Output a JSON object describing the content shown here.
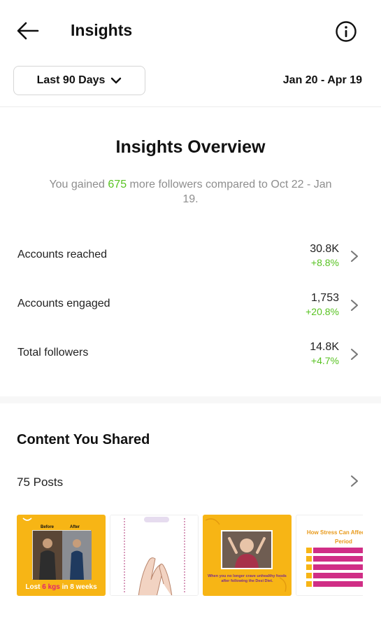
{
  "header": {
    "title": "Insights"
  },
  "range": {
    "label": "Last 90 Days",
    "dates": "Jan 20 - Apr 19"
  },
  "overview": {
    "title": "Insights Overview",
    "sub_prefix": "You gained ",
    "sub_count": "675",
    "sub_suffix": " more followers compared to Oct 22 - Jan 19."
  },
  "metrics": [
    {
      "label": "Accounts reached",
      "value": "30.8K",
      "change": "+8.8%"
    },
    {
      "label": "Accounts engaged",
      "value": "1,753",
      "change": "+20.8%"
    },
    {
      "label": "Total followers",
      "value": "14.8K",
      "change": "+4.7%"
    }
  ],
  "content": {
    "title": "Content You Shared",
    "posts_label": "75 Posts",
    "thumb1": {
      "before": "Before",
      "after": "After",
      "caption_pre": "Lost ",
      "caption_hl": "6 kgs",
      "caption_post": " in 8 weeks"
    },
    "thumb3": {
      "caption": "When you no longer crave unhealthy foods after following the Desi Diet."
    },
    "thumb4": {
      "title": "How Stress Can Affect Your Period"
    }
  },
  "colors": {
    "accent_green": "#58c322",
    "post_yellow": "#f7b515",
    "post_pink": "#d02e86"
  }
}
